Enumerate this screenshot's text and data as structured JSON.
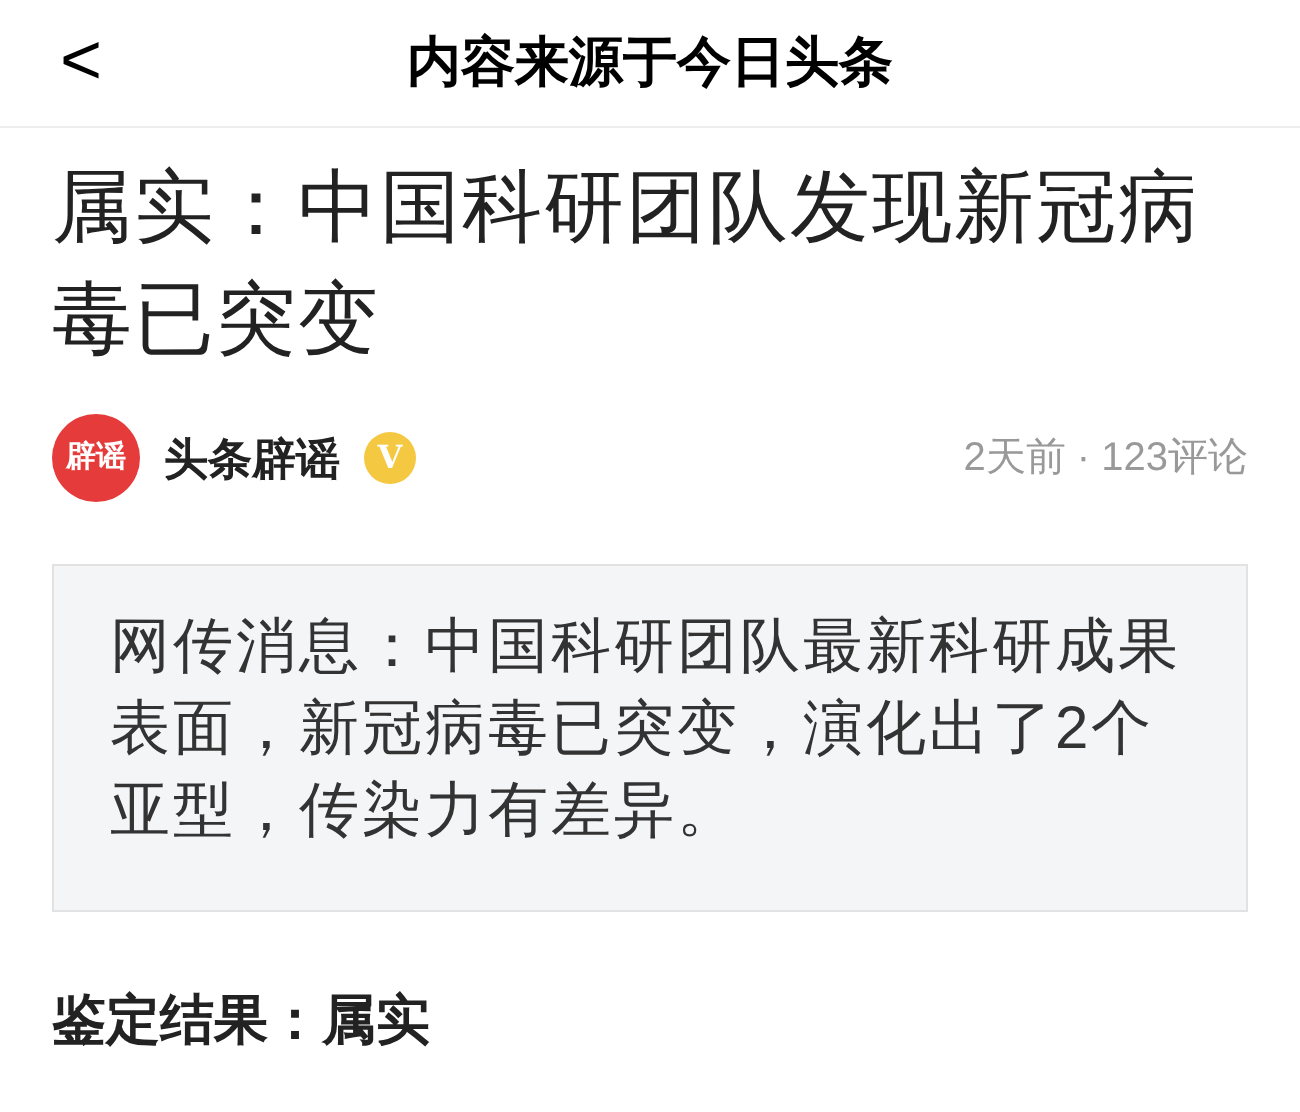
{
  "header": {
    "back": "<",
    "title": "内容来源于今日头条"
  },
  "article": {
    "title": "属实：中国科研团队发现新冠病毒已突变",
    "author": {
      "avatar_text": "辟谣",
      "name": "头条辟谣",
      "verified_badge": "V",
      "meta": "2天前 · 123评论"
    },
    "quote": "网传消息：中国科研团队最新科研成果表面，新冠病毒已突变，演化出了2个亚型，传染力有差异。",
    "result": "鉴定结果：属实"
  }
}
